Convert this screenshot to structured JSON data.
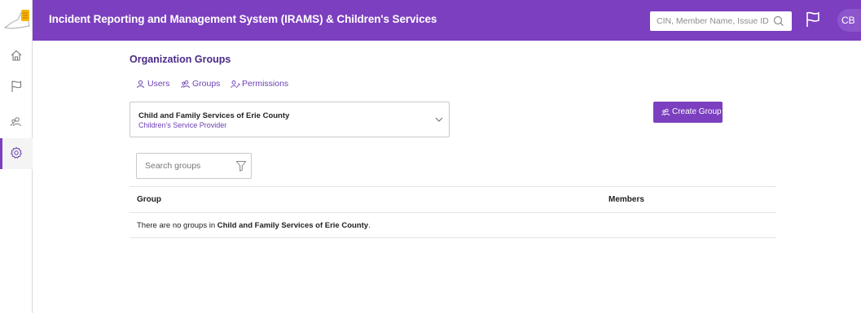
{
  "header": {
    "title": "Incident Reporting and Management System (IRAMS) & Children's Services",
    "search_placeholder": "CIN, Member Name, Issue ID",
    "avatar_initials": "CB",
    "bg_color": "#7b3fbf",
    "icons": {
      "logo": "ny-state-logo-icon",
      "search": "search-icon",
      "flag": "flag-icon"
    }
  },
  "sidebar": {
    "items": [
      {
        "name": "home",
        "icon": "home-icon",
        "active": false
      },
      {
        "name": "issues",
        "icon": "flag-icon",
        "active": false
      },
      {
        "name": "people",
        "icon": "people-icon",
        "active": false
      },
      {
        "name": "settings",
        "icon": "gear-icon",
        "active": true
      }
    ]
  },
  "main": {
    "title": "Organization Groups",
    "tabs": [
      {
        "label": "Users",
        "icon": "user-icon"
      },
      {
        "label": "Groups",
        "icon": "group-icon"
      },
      {
        "label": "Permissions",
        "icon": "permissions-icon"
      }
    ],
    "org_select": {
      "name": "Child and Family Services of Erie County",
      "type": "Children's Service Provider"
    },
    "create_group_label": "Create Group",
    "group_search_placeholder": "Search groups",
    "table": {
      "headers": [
        "Group",
        "Members"
      ],
      "empty_prefix": "There are no groups in ",
      "empty_org": "Child and Family Services of Erie County",
      "empty_suffix": "."
    }
  }
}
